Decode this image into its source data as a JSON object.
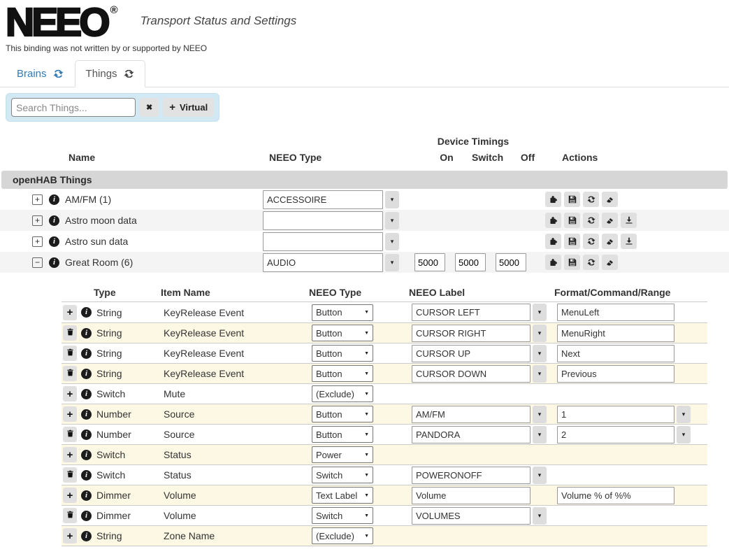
{
  "colors": {
    "accent_blue": "#337ab7",
    "search_panel_bg": "#d2e9f4",
    "section_bar_gray": "#d6d6d6",
    "row_stripe_gray": "#f4f4f4",
    "row_stripe_yellow": "#fcf8e3",
    "button_gray": "#e0e0e0"
  },
  "glyphs": {
    "expand": "+",
    "collapse": "−",
    "info": "i",
    "clear": "✖",
    "add": "+",
    "dropdown": "▾",
    "select_arrow": "▼"
  },
  "header": {
    "logo": "NEEO",
    "registered": "®",
    "subtitle": "Transport Status and Settings",
    "disclaimer": "This binding was not written by or supported by NEEO"
  },
  "tabs": {
    "brains": "Brains",
    "things": "Things"
  },
  "search": {
    "placeholder": "Search Things...",
    "virtual_label": "Virtual"
  },
  "things": {
    "section_title": "openHAB Things",
    "headers": {
      "name": "Name",
      "neeo_type": "NEEO Type",
      "device_timings": "Device Timings",
      "on": "On",
      "switch": "Switch",
      "off": "Off",
      "actions": "Actions"
    },
    "rows": [
      {
        "name": "AM/FM (1)",
        "neeo_type": "ACCESSOIRE"
      },
      {
        "name": "Astro moon data",
        "neeo_type": ""
      },
      {
        "name": "Astro sun data",
        "neeo_type": ""
      },
      {
        "name": "Great Room (6)",
        "neeo_type": "AUDIO",
        "on": "5000",
        "switch": "5000",
        "off": "5000"
      }
    ]
  },
  "channels": {
    "headers": {
      "type": "Type",
      "item_name": "Item Name",
      "neeo_type": "NEEO Type",
      "neeo_label": "NEEO Label",
      "format": "Format/Command/Range"
    },
    "rows": [
      {
        "type": "String",
        "item": "KeyRelease Event",
        "neeo_type": "Button",
        "label": "CURSOR LEFT",
        "format": "MenuLeft"
      },
      {
        "type": "String",
        "item": "KeyRelease Event",
        "neeo_type": "Button",
        "label": "CURSOR RIGHT",
        "format": "MenuRight"
      },
      {
        "type": "String",
        "item": "KeyRelease Event",
        "neeo_type": "Button",
        "label": "CURSOR UP",
        "format": "Next"
      },
      {
        "type": "String",
        "item": "KeyRelease Event",
        "neeo_type": "Button",
        "label": "CURSOR DOWN",
        "format": "Previous"
      },
      {
        "type": "Switch",
        "item": "Mute",
        "neeo_type": "(Exclude)"
      },
      {
        "type": "Number",
        "item": "Source",
        "neeo_type": "Button",
        "label": "AM/FM",
        "format": "1"
      },
      {
        "type": "Number",
        "item": "Source",
        "neeo_type": "Button",
        "label": "PANDORA",
        "format": "2"
      },
      {
        "type": "Switch",
        "item": "Status",
        "neeo_type": "Power"
      },
      {
        "type": "Switch",
        "item": "Status",
        "neeo_type": "Switch",
        "label": "POWERONOFF"
      },
      {
        "type": "Dimmer",
        "item": "Volume",
        "neeo_type": "Text Label",
        "label": "Volume",
        "format": "Volume % of %%"
      },
      {
        "type": "Dimmer",
        "item": "Volume",
        "neeo_type": "Switch",
        "label": "VOLUMES"
      },
      {
        "type": "String",
        "item": "Zone Name",
        "neeo_type": "(Exclude)"
      }
    ]
  }
}
